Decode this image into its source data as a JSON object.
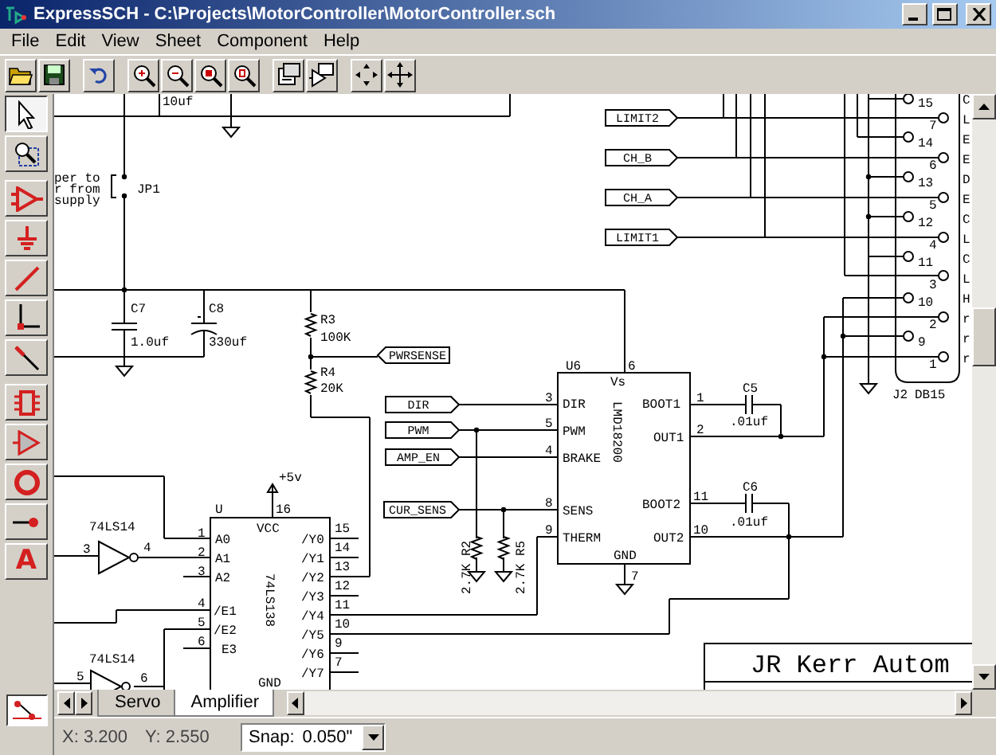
{
  "window": {
    "title": "ExpressSCH - C:\\Projects\\MotorController\\MotorController.sch"
  },
  "menu": [
    {
      "label": "File"
    },
    {
      "label": "Edit"
    },
    {
      "label": "View"
    },
    {
      "label": "Sheet"
    },
    {
      "label": "Component"
    },
    {
      "label": "Help"
    }
  ],
  "palette": [
    {
      "kind": "pointer",
      "selected": true
    },
    {
      "kind": "zoom_select",
      "selected": false
    },
    {
      "kind": "amplifier",
      "selected": false
    },
    {
      "kind": "ground",
      "selected": false
    },
    {
      "kind": "wire",
      "selected": false
    },
    {
      "kind": "junction",
      "selected": false
    },
    {
      "kind": "bus_entry",
      "selected": false
    },
    {
      "kind": "component",
      "selected": false
    },
    {
      "kind": "buffer",
      "selected": false
    },
    {
      "kind": "circle",
      "selected": false
    },
    {
      "kind": "pin",
      "selected": false
    },
    {
      "kind": "text",
      "glyph": "A",
      "selected": false
    }
  ],
  "schematic": {
    "texts": [
      "10uf",
      "per to",
      "r from",
      "supply",
      "JP1",
      "C7",
      "1.0uf",
      "C8",
      "330uf",
      "R3",
      "100K",
      "R4",
      "20K",
      "U6",
      "6",
      "Vs",
      "3",
      "DIR",
      "BOOT1",
      "1",
      "5",
      "PWM",
      "OUT1",
      "2",
      "4",
      "BRAKE",
      "LMD18200",
      "8",
      "SENS",
      "BOOT2",
      "11",
      "9",
      "THERM",
      "OUT2",
      "10",
      "GND",
      "7",
      "C5",
      ".01uf",
      "C6",
      ".01uf",
      "2.7K R2",
      "2.7K R5",
      "J2",
      "DB15",
      "+5v",
      "U",
      "16",
      "VCC",
      "74LS14",
      "3",
      "4",
      "1",
      "A0",
      "2",
      "A1",
      "3",
      "A2",
      "4",
      "/E1",
      "5",
      "/E2",
      "6",
      "E3",
      "/Y0",
      "15",
      "/Y1",
      "14",
      "/Y2",
      "13",
      "/Y3",
      "12",
      "/Y4",
      "11",
      "/Y5",
      "10",
      "/Y6",
      "9",
      "/Y7",
      "7",
      "74LS138",
      "GND",
      "74LS14",
      "5",
      "6",
      "15",
      "7",
      "14",
      "6",
      "13",
      "5",
      "12",
      "4",
      "11",
      "3",
      "10",
      "2",
      "9",
      "1",
      "C",
      "L",
      "E",
      "E",
      "D",
      "E",
      "C",
      "L",
      "C",
      "L",
      "H",
      "r",
      "r",
      "r"
    ],
    "net_labels": [
      "LIMIT2",
      "CH_B",
      "CH_A",
      "LIMIT1",
      "PWRSENSE",
      "DIR",
      "PWM",
      "AMP_EN",
      "CUR_SENS"
    ],
    "title_block": "JR Kerr Autom"
  },
  "sheet_tabs": [
    {
      "label": "Servo",
      "selected": false
    },
    {
      "label": "Amplifier",
      "selected": true
    }
  ],
  "status_bar": {
    "x": "X: 3.200",
    "y": "Y: 2.550",
    "snap_label": "Snap:",
    "snap_value": "0.050\""
  }
}
